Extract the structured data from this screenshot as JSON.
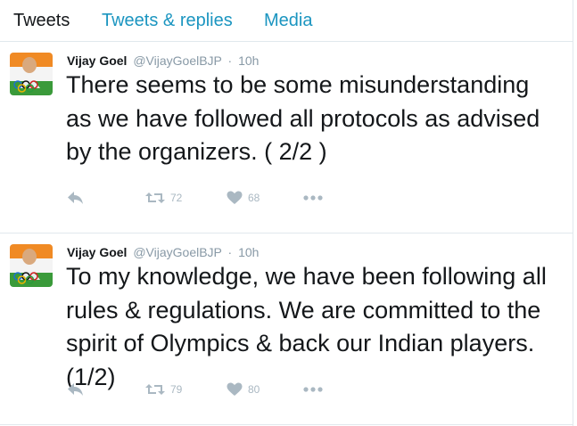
{
  "tabs": [
    {
      "label": "Tweets"
    },
    {
      "label": "Tweets & replies"
    },
    {
      "label": "Media"
    }
  ],
  "colors": {
    "link": "#1b95c0",
    "text": "#14171a",
    "muted": "#8899a6",
    "action": "#aab8c2",
    "divider": "#e1e8ed"
  },
  "tweets": [
    {
      "name": "Vijay Goel",
      "handle": "@VijayGoelBJP",
      "separator": "·",
      "time": "10h",
      "text": "There seems to be some misunderstanding as we have followed all protocols as advised by the organizers. ( 2/2 )",
      "retweets": "72",
      "likes": "68"
    },
    {
      "name": "Vijay Goel",
      "handle": "@VijayGoelBJP",
      "separator": "·",
      "time": "10h",
      "text": "To my knowledge, we have been following all rules & regulations. We are committed to the spirit of Olympics & back our Indian players. (1/2)",
      "retweets": "79",
      "likes": "80"
    }
  ],
  "icons": [
    "reply-icon",
    "retweet-icon",
    "like-icon",
    "more-icon"
  ]
}
